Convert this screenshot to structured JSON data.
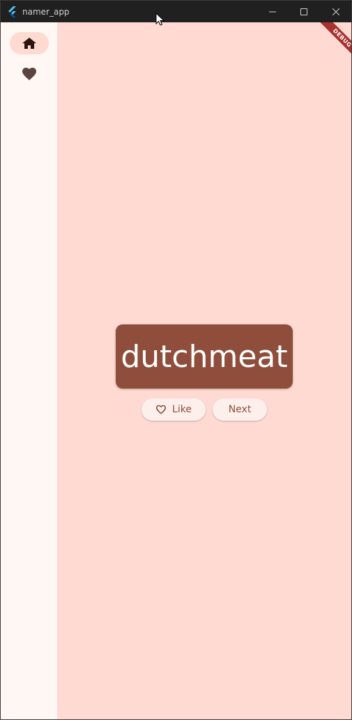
{
  "window": {
    "title": "namer_app"
  },
  "rail": {
    "items": [
      {
        "name": "home",
        "icon": "home-icon",
        "selected": true
      },
      {
        "name": "favorites",
        "icon": "heart-icon",
        "selected": false
      }
    ]
  },
  "main": {
    "word_pair": "dutchmeat",
    "like_label": "Like",
    "next_label": "Next"
  },
  "debug_banner": "DEBUG",
  "colors": {
    "card": "#8e4e3b",
    "background": "#ffdad3",
    "rail": "#fff7f4",
    "selected_indicator": "#ffdad1",
    "banner": "#a8322f"
  }
}
